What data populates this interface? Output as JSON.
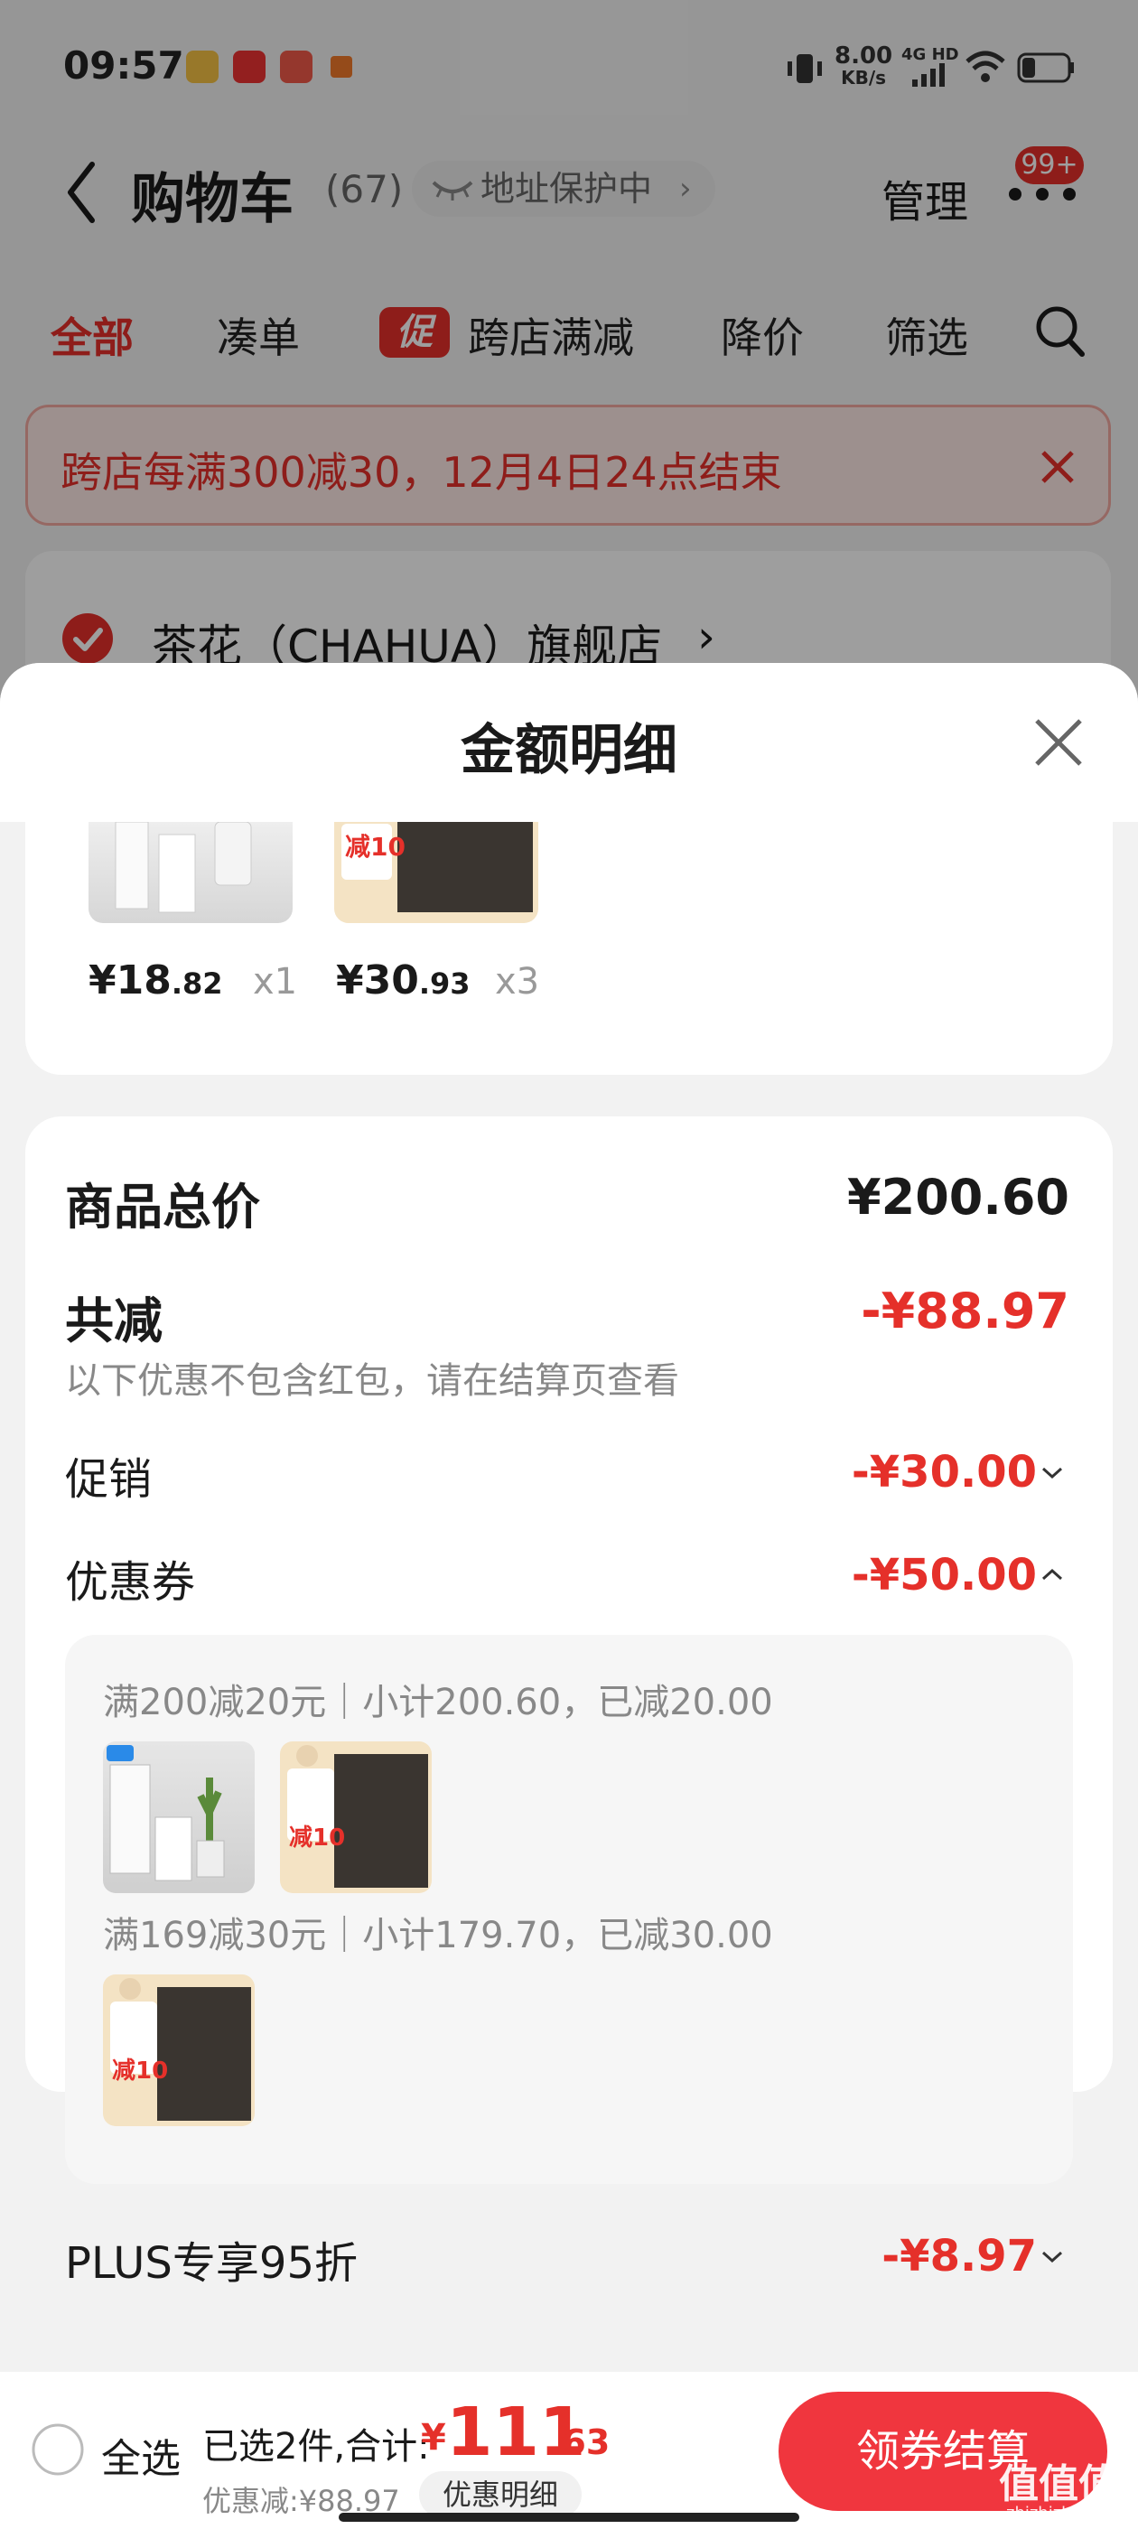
{
  "status_bar": {
    "time": "09:57",
    "net_speed": "8.00",
    "net_unit": "KB/s",
    "net_type": "4G HD"
  },
  "header": {
    "back_icon": "chevron-left-icon",
    "title": "购物车",
    "count": "(67)",
    "address_protect": "地址保护中",
    "manage": "管理",
    "badge": "99+"
  },
  "tabs": {
    "all": "全部",
    "combine": "凑单",
    "promo_tag": "促",
    "cross_store": "跨店满减",
    "price_drop": "降价",
    "filter": "筛选"
  },
  "notice": {
    "text": "跨店每满300减30，12月4日24点结束"
  },
  "store": {
    "name": "茶花（CHAHUA）旗舰店"
  },
  "sheet": {
    "title": "金额明细",
    "items": [
      {
        "price_int": "¥18",
        "price_dec": ".82",
        "qty": "x1"
      },
      {
        "price_int": "¥30",
        "price_dec": ".93",
        "qty": "x3"
      }
    ],
    "total_label": "商品总价",
    "total_value": "¥200.60",
    "discount_label": "共减",
    "discount_value": "-¥88.97",
    "discount_note": "以下优惠不包含红包，请在结算页查看",
    "promo_label": "促销",
    "promo_value": "-¥30.00",
    "coupon_label": "优惠券",
    "coupon_value": "-¥50.00",
    "coupon_rule_1": "满200减20元｜小计200.60，已减20.00",
    "coupon_rule_2": "满169减30元｜小计179.70，已减30.00",
    "promo_badge": "减10",
    "plus_label": "PLUS专享95折",
    "plus_value": "-¥8.97"
  },
  "bottom_bar": {
    "select_all": "全选",
    "selected_summary": "已选2件,合计:",
    "currency": "¥",
    "total_int": "111",
    "total_dec": ".63",
    "saved": "优惠减:¥88.97",
    "detail_button": "优惠明细",
    "checkout_button": "领券结算"
  },
  "watermark": {
    "text": "值值值",
    "sub": "zhizhizhi.com"
  },
  "colors": {
    "accent": "#e5302a",
    "checkout": "#f0363e"
  }
}
